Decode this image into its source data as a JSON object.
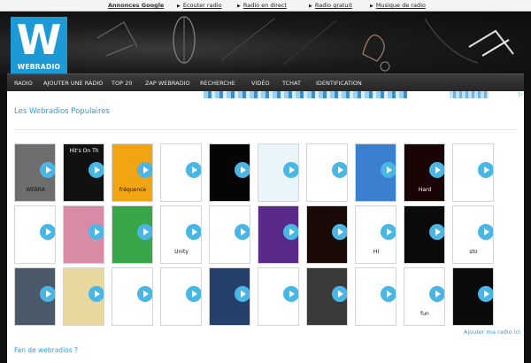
{
  "adbar": {
    "label": "Annonces Google",
    "links": [
      "Ecouter radio",
      "Radio en direct",
      "Radio gratuit",
      "Musique de radio"
    ]
  },
  "logo": {
    "letter": "W",
    "text": "WEBRADIO"
  },
  "nav": [
    "RADIO",
    "AJOUTER UNE RADIO",
    "TOP 20",
    "ZAP WEBRADIO",
    "RECHERCHE",
    "VIDÉO",
    "TCHAT",
    "IDENTIFICATION"
  ],
  "section": {
    "title": "Les Webradios Populaires"
  },
  "tiles": [
    {
      "label": "WEBRA",
      "bg": "#6e6e6e"
    },
    {
      "label": "Hit's On Th",
      "bg": "#111111"
    },
    {
      "label": "fréquence",
      "bg": "#f2a512"
    },
    {
      "label": "",
      "bg": "#ffffff"
    },
    {
      "label": "",
      "bg": "#050505"
    },
    {
      "label": "",
      "bg": "#eaf4fb"
    },
    {
      "label": "",
      "bg": "#ffffff"
    },
    {
      "label": "",
      "bg": "#3a7fd0"
    },
    {
      "label": "Hard",
      "bg": "#1a0505"
    },
    {
      "label": "",
      "bg": "#ffffff"
    },
    {
      "label": "",
      "bg": "#ffffff"
    },
    {
      "label": "",
      "bg": "#d98aa5"
    },
    {
      "label": "",
      "bg": "#3aa64a"
    },
    {
      "label": "Unity",
      "bg": "#ffffff"
    },
    {
      "label": "",
      "bg": "#ffffff"
    },
    {
      "label": "",
      "bg": "#5a2a8a"
    },
    {
      "label": "",
      "bg": "#1a0a05"
    },
    {
      "label": "HI",
      "bg": "#ffffff"
    },
    {
      "label": "",
      "bg": "#0a0a0a"
    },
    {
      "label": "sto",
      "bg": "#ffffff"
    },
    {
      "label": "",
      "bg": "#4a5a6a"
    },
    {
      "label": "",
      "bg": "#e8d8a0"
    },
    {
      "label": "",
      "bg": "#ffffff"
    },
    {
      "label": "",
      "bg": "#ffffff"
    },
    {
      "label": "",
      "bg": "#24406a"
    },
    {
      "label": "",
      "bg": "#ffffff"
    },
    {
      "label": "",
      "bg": "#3a3a3a"
    },
    {
      "label": "",
      "bg": "#ffffff"
    },
    {
      "label": "fun",
      "bg": "#ffffff"
    },
    {
      "label": "",
      "bg": "#0a0a0a"
    }
  ],
  "footer": {
    "add_link": "Ajouter ma radio ici",
    "fan_title": "Fan de webradios ?"
  },
  "colors": {
    "accent": "#2a9fd8",
    "logo_bg": "#1d9ad6",
    "nav_bg": "#2f2f2f",
    "play": "#4ab6e6"
  }
}
